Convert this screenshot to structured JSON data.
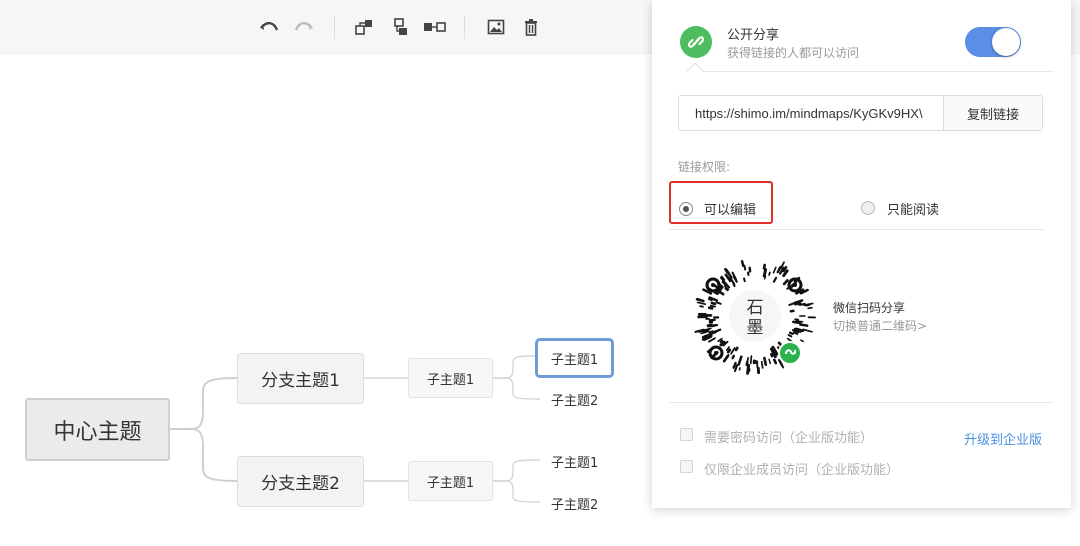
{
  "toolbar": {
    "buttons": [
      "undo-icon",
      "redo-icon",
      "add-child-topic-icon",
      "add-sibling-topic-icon",
      "add-parent-topic-icon",
      "insert-image-icon",
      "delete-icon"
    ]
  },
  "mindmap": {
    "center": "中心主题",
    "branches": [
      {
        "label": "分支主题1",
        "sub": "子主题1",
        "leaves": [
          "子主题1",
          "子主题2"
        ]
      },
      {
        "label": "分支主题2",
        "sub": "子主题1",
        "leaves": [
          "子主题1",
          "子主题2"
        ]
      }
    ],
    "selected_leaf": "子主题1"
  },
  "share_panel": {
    "title": "公开分享",
    "subtitle": "获得链接的人都可以访问",
    "public_enabled": true,
    "url": "https://shimo.im/mindmaps/KyGKv9HX\\",
    "copy_label": "复制链接",
    "permission_label": "链接权限:",
    "permissions": [
      {
        "label": "可以编辑",
        "selected": true
      },
      {
        "label": "只能阅读",
        "selected": false
      }
    ],
    "qr_logo_text": [
      "石",
      "墨"
    ],
    "qr_title": "微信扫码分享",
    "qr_switch": "切换普通二维码>",
    "options": [
      {
        "label": "需要密码访问（企业版功能）",
        "checked": false
      },
      {
        "label": "仅限企业成员访问（企业版功能）",
        "checked": false
      }
    ],
    "upgrade_label": "升级到企业版",
    "accent_color": "#5b8ee6",
    "link_icon_color": "#4dbd60",
    "highlight_color": "#e0312b"
  }
}
